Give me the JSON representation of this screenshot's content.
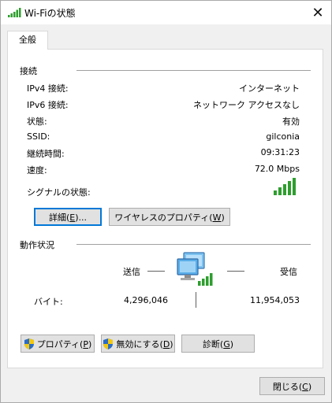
{
  "window": {
    "title": "Wi-Fiの状態",
    "close_glyph": "✕"
  },
  "tab": {
    "label": "全般"
  },
  "connection": {
    "section_title": "接続",
    "rows": [
      {
        "label": "IPv4 接続:",
        "value": "インターネット"
      },
      {
        "label": "IPv6 接続:",
        "value": "ネットワーク アクセスなし"
      },
      {
        "label": "状態:",
        "value": "有効"
      },
      {
        "label": "SSID:",
        "value": "gilconia"
      },
      {
        "label": "継続時間:",
        "value": "09:31:23"
      },
      {
        "label": "速度:",
        "value": "72.0 Mbps"
      }
    ],
    "signal_label": "シグナルの状態:",
    "signal_bars": 5,
    "signal_max": 5,
    "details_button": {
      "text": "詳細(",
      "key": "E",
      "suffix": ")..."
    },
    "wireless_props_button": {
      "text": "ワイヤレスのプロパティ(",
      "key": "W",
      "suffix": ")"
    }
  },
  "activity": {
    "section_title": "動作状況",
    "sent_label": "送信",
    "received_label": "受信",
    "bytes_label": "バイト:",
    "bytes_sent": "4,296,046",
    "bytes_received": "11,954,053"
  },
  "buttons": {
    "properties": {
      "text": "プロパティ(",
      "key": "P",
      "suffix": ")"
    },
    "disable": {
      "text": "無効にする(",
      "key": "D",
      "suffix": ")"
    },
    "diagnose": {
      "text": "診断(",
      "key": "G",
      "suffix": ")"
    },
    "close": {
      "text": "閉じる(",
      "key": "C",
      "suffix": ")"
    }
  },
  "colors": {
    "signal": "#2e9e2e",
    "focus_border": "#0078d7"
  }
}
